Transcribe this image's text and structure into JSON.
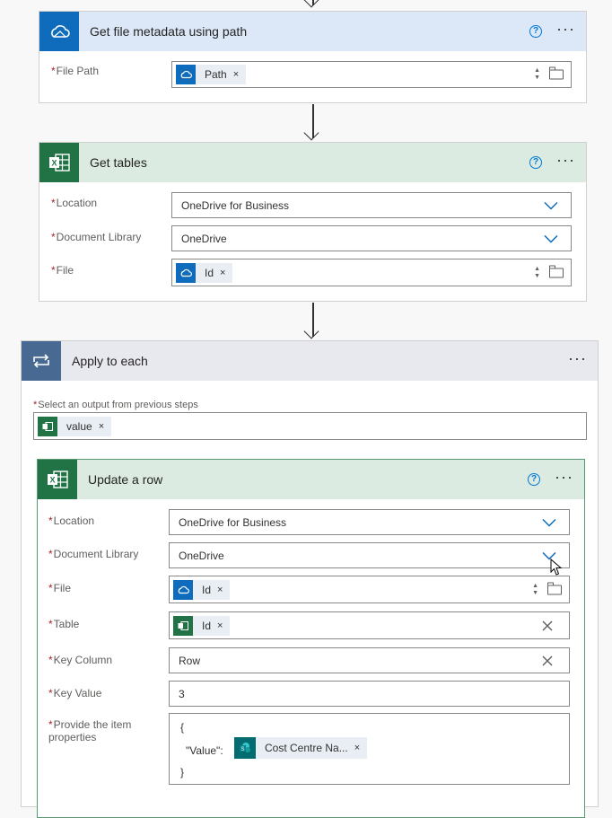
{
  "colors": {
    "onedrive_header": "#dce8f7",
    "onedrive_brand": "#0f6cbd",
    "excel_header": "#dcebe2",
    "excel_brand": "#217346",
    "loop_header": "#e8e8ef",
    "loop_brand": "#486991",
    "sharepoint_brand": "#036c70",
    "help": "#0078d4"
  },
  "card1": {
    "title": "Get file metadata using path",
    "icon": "cloud-icon",
    "fields": [
      {
        "label": "File Path",
        "token": "Path",
        "token_icon": "cloud-icon"
      }
    ]
  },
  "card2": {
    "title": "Get tables",
    "icon": "excel-icon",
    "fields": [
      {
        "label": "Location",
        "value": "OneDrive for Business"
      },
      {
        "label": "Document Library",
        "value": "OneDrive"
      },
      {
        "label": "File",
        "token": "Id",
        "token_icon": "cloud-icon"
      }
    ]
  },
  "loop": {
    "title": "Apply to each",
    "icon": "loop-icon",
    "output_label": "Select an output from previous steps",
    "output_token": "value",
    "output_token_icon": "excel-icon"
  },
  "card3": {
    "title": "Update a row",
    "icon": "excel-icon",
    "fields": [
      {
        "label": "Location",
        "value": "OneDrive for Business"
      },
      {
        "label": "Document Library",
        "value": "OneDrive"
      },
      {
        "label": "File",
        "token": "Id",
        "token_icon": "cloud-icon"
      },
      {
        "label": "Table",
        "token": "Id",
        "token_icon": "excel-icon"
      },
      {
        "label": "Key Column",
        "value": "Row"
      },
      {
        "label": "Key Value",
        "value": "3"
      },
      {
        "label": "Provide the item properties",
        "label_line1": "Provide the item",
        "label_line2": "properties"
      }
    ],
    "json_open": "{",
    "json_key": "\"Value\":",
    "json_token": "Cost Centre Na...",
    "json_token_icon": "sharepoint-icon",
    "json_close": "}"
  },
  "common": {
    "required_mark": "*",
    "more": "···",
    "help": "?",
    "token_remove": "×"
  }
}
